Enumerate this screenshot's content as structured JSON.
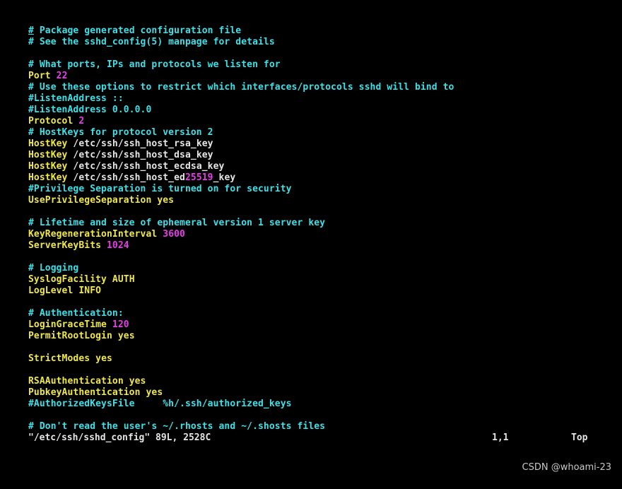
{
  "editor": {
    "lines": [
      [
        {
          "t": "#",
          "c": "cursor"
        },
        {
          "t": " Package generated configuration file",
          "c": "comment"
        }
      ],
      [
        {
          "t": "# See the sshd_config(5) manpage for details",
          "c": "comment"
        }
      ],
      [],
      [
        {
          "t": "# What ports, IPs and protocols we listen for",
          "c": "comment"
        }
      ],
      [
        {
          "t": "Port",
          "c": "keyword"
        },
        {
          "t": " ",
          "c": "value"
        },
        {
          "t": "22",
          "c": "number"
        }
      ],
      [
        {
          "t": "# Use these options to restrict which interfaces/protocols sshd will bind to",
          "c": "comment"
        }
      ],
      [
        {
          "t": "#ListenAddress ::",
          "c": "comment"
        }
      ],
      [
        {
          "t": "#ListenAddress 0.0.0.0",
          "c": "comment"
        }
      ],
      [
        {
          "t": "Protocol",
          "c": "keyword"
        },
        {
          "t": " ",
          "c": "value"
        },
        {
          "t": "2",
          "c": "number"
        }
      ],
      [
        {
          "t": "# HostKeys for protocol version 2",
          "c": "comment"
        }
      ],
      [
        {
          "t": "HostKey",
          "c": "keyword"
        },
        {
          "t": " /etc/ssh/ssh_host_rsa_key",
          "c": "value"
        }
      ],
      [
        {
          "t": "HostKey",
          "c": "keyword"
        },
        {
          "t": " /etc/ssh/ssh_host_dsa_key",
          "c": "value"
        }
      ],
      [
        {
          "t": "HostKey",
          "c": "keyword"
        },
        {
          "t": " /etc/ssh/ssh_host_ecdsa_key",
          "c": "value"
        }
      ],
      [
        {
          "t": "HostKey",
          "c": "keyword"
        },
        {
          "t": " /etc/ssh/ssh_host_ed",
          "c": "value"
        },
        {
          "t": "25519",
          "c": "number"
        },
        {
          "t": "_key",
          "c": "value"
        }
      ],
      [
        {
          "t": "#Privilege Separation is turned on for security",
          "c": "comment"
        }
      ],
      [
        {
          "t": "UsePrivilegeSeparation",
          "c": "keyword"
        },
        {
          "t": " ",
          "c": "value"
        },
        {
          "t": "yes",
          "c": "keyword"
        }
      ],
      [],
      [
        {
          "t": "# Lifetime and size of ephemeral version 1 server key",
          "c": "comment"
        }
      ],
      [
        {
          "t": "KeyRegenerationInterval",
          "c": "keyword"
        },
        {
          "t": " ",
          "c": "value"
        },
        {
          "t": "3600",
          "c": "number"
        }
      ],
      [
        {
          "t": "ServerKeyBits",
          "c": "keyword"
        },
        {
          "t": " ",
          "c": "value"
        },
        {
          "t": "1024",
          "c": "number"
        }
      ],
      [],
      [
        {
          "t": "# Logging",
          "c": "comment"
        }
      ],
      [
        {
          "t": "SyslogFacility",
          "c": "keyword"
        },
        {
          "t": " ",
          "c": "value"
        },
        {
          "t": "AUTH",
          "c": "keyword"
        }
      ],
      [
        {
          "t": "LogLevel",
          "c": "keyword"
        },
        {
          "t": " ",
          "c": "value"
        },
        {
          "t": "INFO",
          "c": "keyword"
        }
      ],
      [],
      [
        {
          "t": "# Authentication:",
          "c": "comment"
        }
      ],
      [
        {
          "t": "LoginGraceTime",
          "c": "keyword"
        },
        {
          "t": " ",
          "c": "value"
        },
        {
          "t": "120",
          "c": "number"
        }
      ],
      [
        {
          "t": "PermitRootLogin",
          "c": "keyword"
        },
        {
          "t": " ",
          "c": "value"
        },
        {
          "t": "yes",
          "c": "keyword"
        }
      ],
      [],
      [
        {
          "t": "StrictModes",
          "c": "keyword"
        },
        {
          "t": " ",
          "c": "value"
        },
        {
          "t": "yes",
          "c": "keyword"
        }
      ],
      [],
      [
        {
          "t": "RSAAuthentication",
          "c": "keyword"
        },
        {
          "t": " ",
          "c": "value"
        },
        {
          "t": "yes",
          "c": "keyword"
        }
      ],
      [
        {
          "t": "PubkeyAuthentication",
          "c": "keyword"
        },
        {
          "t": " ",
          "c": "value"
        },
        {
          "t": "yes",
          "c": "keyword"
        }
      ],
      [
        {
          "t": "#AuthorizedKeysFile     %h/.ssh/authorized_keys",
          "c": "comment"
        }
      ],
      [],
      [
        {
          "t": "# Don't read the user's ~/.rhosts and ~/.shosts files",
          "c": "comment"
        }
      ]
    ]
  },
  "status": {
    "file": "\"/etc/ssh/sshd_config\" 89L, 2528C",
    "position": "1,1",
    "scroll": "Top"
  },
  "watermark": "CSDN @whoami-23",
  "colors": {
    "background": "#000000",
    "comment": "#3ee0e8",
    "keyword": "#f0e84a",
    "value": "#e6e6e6",
    "number": "#e93be9"
  }
}
